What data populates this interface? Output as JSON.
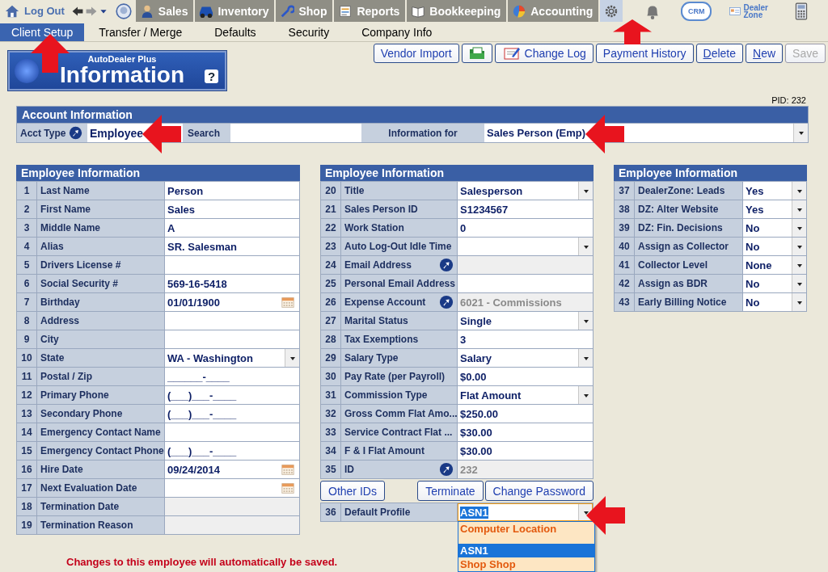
{
  "nav": {
    "logout": "Log Out",
    "modules": [
      {
        "label": "Sales",
        "selected": false
      },
      {
        "label": "Inventory",
        "selected": false
      },
      {
        "label": "Shop",
        "selected": false
      },
      {
        "label": "Reports",
        "selected": false
      },
      {
        "label": "Bookkeeping",
        "selected": false
      },
      {
        "label": "Accounting",
        "selected": false
      },
      {
        "selected": true
      }
    ],
    "tools": [
      {
        "kind": "icon"
      },
      {
        "kind": "badge",
        "label": "CRM"
      },
      {
        "kind": "link",
        "label": "Dealer Zone"
      },
      {
        "kind": "icon"
      }
    ]
  },
  "sub_tabs": [
    {
      "label": "Client Setup",
      "selected": true
    },
    {
      "label": "Transfer / Merge",
      "selected": false
    },
    {
      "label": "Defaults",
      "selected": false
    },
    {
      "label": "Security",
      "selected": false
    },
    {
      "label": "Company Info",
      "selected": false
    }
  ],
  "logo": {
    "brand": "AutoDealer Plus",
    "title": "Information",
    "help": "?"
  },
  "toolbar": [
    {
      "kind": "text",
      "label": "Vendor Import",
      "mnemonic": false,
      "disabled": false
    },
    {
      "kind": "icon",
      "disabled": false
    },
    {
      "kind": "icon-text",
      "label": "Change Log",
      "mnemonic": false,
      "disabled": false
    },
    {
      "kind": "text",
      "label": "Payment History",
      "mnemonic": false,
      "disabled": false
    },
    {
      "kind": "text",
      "label": "Delete",
      "mnemonic": true,
      "disabled": false
    },
    {
      "kind": "text",
      "label": "New",
      "mnemonic": true,
      "disabled": false
    },
    {
      "kind": "text",
      "label": "Save",
      "mnemonic": false,
      "disabled": true
    }
  ],
  "pid": "PID: 232",
  "account": {
    "title": "Account Information",
    "acct_type_label": "Acct Type",
    "acct_type": "Employee",
    "search_label": "Search",
    "info_for_label": "Information for",
    "info_for": "Sales Person (Emp)"
  },
  "panels": [
    {
      "title": "Employee Information",
      "rows": [
        {
          "num": "1",
          "label": "Last Name",
          "kind": "text",
          "value": "Person"
        },
        {
          "num": "2",
          "label": "First Name",
          "kind": "text",
          "value": "Sales"
        },
        {
          "num": "3",
          "label": "Middle Name",
          "kind": "text",
          "value": "A"
        },
        {
          "num": "4",
          "label": "Alias",
          "kind": "text",
          "value": "SR. Salesman"
        },
        {
          "num": "5",
          "label": "Drivers License #",
          "kind": "text"
        },
        {
          "num": "6",
          "label": "Social Security #",
          "kind": "text",
          "value": "569-16-5418"
        },
        {
          "num": "7",
          "label": "Birthday",
          "kind": "date",
          "value": "01/01/1900"
        },
        {
          "num": "8",
          "label": "Address",
          "kind": "text"
        },
        {
          "num": "9",
          "label": "City",
          "kind": "text"
        },
        {
          "num": "10",
          "label": "State",
          "kind": "select",
          "value": "WA - Washington"
        },
        {
          "num": "11",
          "label": "Postal / Zip",
          "kind": "text",
          "value": "______-____"
        },
        {
          "num": "12",
          "label": "Primary Phone",
          "kind": "text",
          "value": "(___)___-____"
        },
        {
          "num": "13",
          "label": "Secondary Phone",
          "kind": "text",
          "value": "(___)___-____"
        },
        {
          "num": "14",
          "label": "Emergency Contact Name",
          "kind": "text"
        },
        {
          "num": "15",
          "label": "Emergency Contact Phone",
          "kind": "text",
          "value": "(___)___-____"
        },
        {
          "num": "16",
          "label": "Hire Date",
          "kind": "date",
          "value": "09/24/2014"
        },
        {
          "num": "17",
          "label": "Next Evaluation Date",
          "kind": "date"
        },
        {
          "num": "18",
          "label": "Termination Date",
          "kind": "readonly"
        },
        {
          "num": "19",
          "label": "Termination Reason",
          "kind": "readonly"
        }
      ]
    },
    {
      "title": "Employee Information",
      "rows": [
        {
          "num": "20",
          "label": "Title",
          "kind": "select",
          "value": "Salesperson"
        },
        {
          "num": "21",
          "label": "Sales Person ID",
          "kind": "text",
          "value": "S1234567"
        },
        {
          "num": "22",
          "label": "Work Station",
          "kind": "text",
          "value": "0"
        },
        {
          "num": "23",
          "label": "Auto Log-Out Idle Time",
          "kind": "select"
        },
        {
          "num": "24",
          "label": "Email Address",
          "kind": "lookup"
        },
        {
          "num": "25",
          "label": "Personal Email Address",
          "kind": "text"
        },
        {
          "num": "26",
          "label": "Expense Account",
          "kind": "lookup",
          "value": "6021 - Commissions"
        },
        {
          "num": "27",
          "label": "Marital Status",
          "kind": "select",
          "value": "Single"
        },
        {
          "num": "28",
          "label": "Tax Exemptions",
          "kind": "text",
          "value": "3"
        },
        {
          "num": "29",
          "label": "Salary Type",
          "kind": "select",
          "value": "Salary"
        },
        {
          "num": "30",
          "label": "Pay Rate (per Payroll)",
          "kind": "text",
          "value": "$0.00"
        },
        {
          "num": "31",
          "label": "Commission Type",
          "kind": "select",
          "value": "Flat Amount"
        },
        {
          "num": "32",
          "label": "Gross Comm Flat Amo...",
          "kind": "text",
          "value": "$250.00"
        },
        {
          "num": "33",
          "label": "Service Contract Flat ...",
          "kind": "text",
          "value": "$30.00"
        },
        {
          "num": "34",
          "label": "F & I Flat Amount",
          "kind": "text",
          "value": "$30.00"
        },
        {
          "num": "35",
          "label": "ID",
          "kind": "lookup",
          "value": "232"
        }
      ],
      "buttons": [
        "Other IDs",
        "Terminate",
        "Change Password"
      ],
      "footer_row": {
        "num": "36",
        "label": "Default Profile",
        "kind": "select",
        "value": "ASN1",
        "open": true,
        "options": [
          {
            "label": "Computer Location",
            "selected": false
          },
          {
            "label": "ASN1",
            "selected": true
          },
          {
            "label": "Shop Shop",
            "selected": false
          }
        ]
      }
    },
    {
      "title": "Employee Information",
      "rows": [
        {
          "num": "37",
          "label": "DealerZone:  Leads",
          "kind": "select",
          "value": "Yes"
        },
        {
          "num": "38",
          "label": "DZ: Alter Website",
          "kind": "select",
          "value": "Yes"
        },
        {
          "num": "39",
          "label": "DZ:  Fin. Decisions",
          "kind": "select",
          "value": "No"
        },
        {
          "num": "40",
          "label": "Assign as Collector",
          "kind": "select",
          "value": "No"
        },
        {
          "num": "41",
          "label": "Collector Level",
          "kind": "select",
          "value": "None"
        },
        {
          "num": "42",
          "label": "Assign as BDR",
          "kind": "select",
          "value": "No"
        },
        {
          "num": "43",
          "label": "Early Billing Notice",
          "kind": "select",
          "value": "No"
        }
      ]
    }
  ],
  "notice": "Changes to this employee will automatically be saved."
}
